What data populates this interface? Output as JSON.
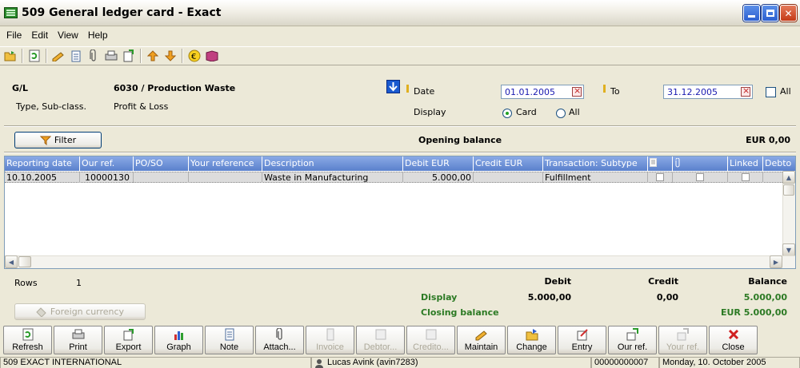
{
  "window": {
    "title": "509 General ledger card - Exact"
  },
  "menu": [
    "File",
    "Edit",
    "View",
    "Help"
  ],
  "header": {
    "gl_label": "G/L",
    "gl_value": "6030 / Production Waste",
    "type_label": "Type, Sub-class.",
    "type_value": "Profit & Loss",
    "date_label": "Date",
    "date_from": "01.01.2005",
    "to_label": "To",
    "date_to": "31.12.2005",
    "all_label": "All",
    "display_label": "Display",
    "display_card": "Card",
    "display_all": "All",
    "display_selected": "Card"
  },
  "filter": {
    "button_label": "Filter",
    "opening_balance_label": "Opening balance",
    "opening_balance_value": "EUR 0,00"
  },
  "grid": {
    "columns": [
      "Reporting date",
      "Our ref.",
      "PO/SO",
      "Your reference",
      "Description",
      "Debit EUR",
      "Credit EUR",
      "Transaction: Subtype",
      "",
      "",
      "Linked",
      "Debto"
    ],
    "rows": [
      [
        "10.10.2005",
        "10000130",
        "",
        "",
        "Waste in Manufacturing",
        "5.000,00",
        "",
        "Fulfillment",
        "",
        "",
        "",
        ""
      ]
    ]
  },
  "summary": {
    "rows_label": "Rows",
    "rows_value": "1",
    "debit_label": "Debit",
    "credit_label": "Credit",
    "balance_label": "Balance",
    "display_label": "Display",
    "display_debit": "5.000,00",
    "display_credit": "0,00",
    "display_balance": "5.000,00",
    "closing_label": "Closing balance",
    "closing_balance": "EUR 5.000,00",
    "foreign_currency": "Foreign currency"
  },
  "buttons": [
    {
      "label": "Refresh",
      "enabled": true,
      "icon": "refresh-icon"
    },
    {
      "label": "Print",
      "enabled": true,
      "icon": "print-icon"
    },
    {
      "label": "Export",
      "enabled": true,
      "icon": "export-icon"
    },
    {
      "label": "Graph",
      "enabled": true,
      "icon": "graph-icon"
    },
    {
      "label": "Note",
      "enabled": true,
      "icon": "note-icon"
    },
    {
      "label": "Attach...",
      "enabled": true,
      "icon": "paperclip-icon"
    },
    {
      "label": "Invoice",
      "enabled": false,
      "icon": "invoice-icon"
    },
    {
      "label": "Debtor...",
      "enabled": false,
      "icon": "debtor-icon"
    },
    {
      "label": "Credito...",
      "enabled": false,
      "icon": "creditor-icon"
    },
    {
      "label": "Maintain",
      "enabled": true,
      "icon": "maintain-icon"
    },
    {
      "label": "Change",
      "enabled": true,
      "icon": "change-icon"
    },
    {
      "label": "Entry",
      "enabled": true,
      "icon": "entry-icon"
    },
    {
      "label": "Our ref.",
      "enabled": true,
      "icon": "our-ref-icon"
    },
    {
      "label": "Your ref.",
      "enabled": false,
      "icon": "your-ref-icon"
    },
    {
      "label": "Close",
      "enabled": true,
      "icon": "close-icon"
    }
  ],
  "status": {
    "company": "509 EXACT INTERNATIONAL",
    "user": "Lucas Avink (avin7283)",
    "code": "00000000007",
    "date": "Monday, 10. October 2005"
  },
  "colors": {
    "window_bg": "#ece9d8",
    "grid_header": "#6c91d6",
    "green_text": "#2c7a24",
    "link_blue": "#1a1ab0"
  }
}
